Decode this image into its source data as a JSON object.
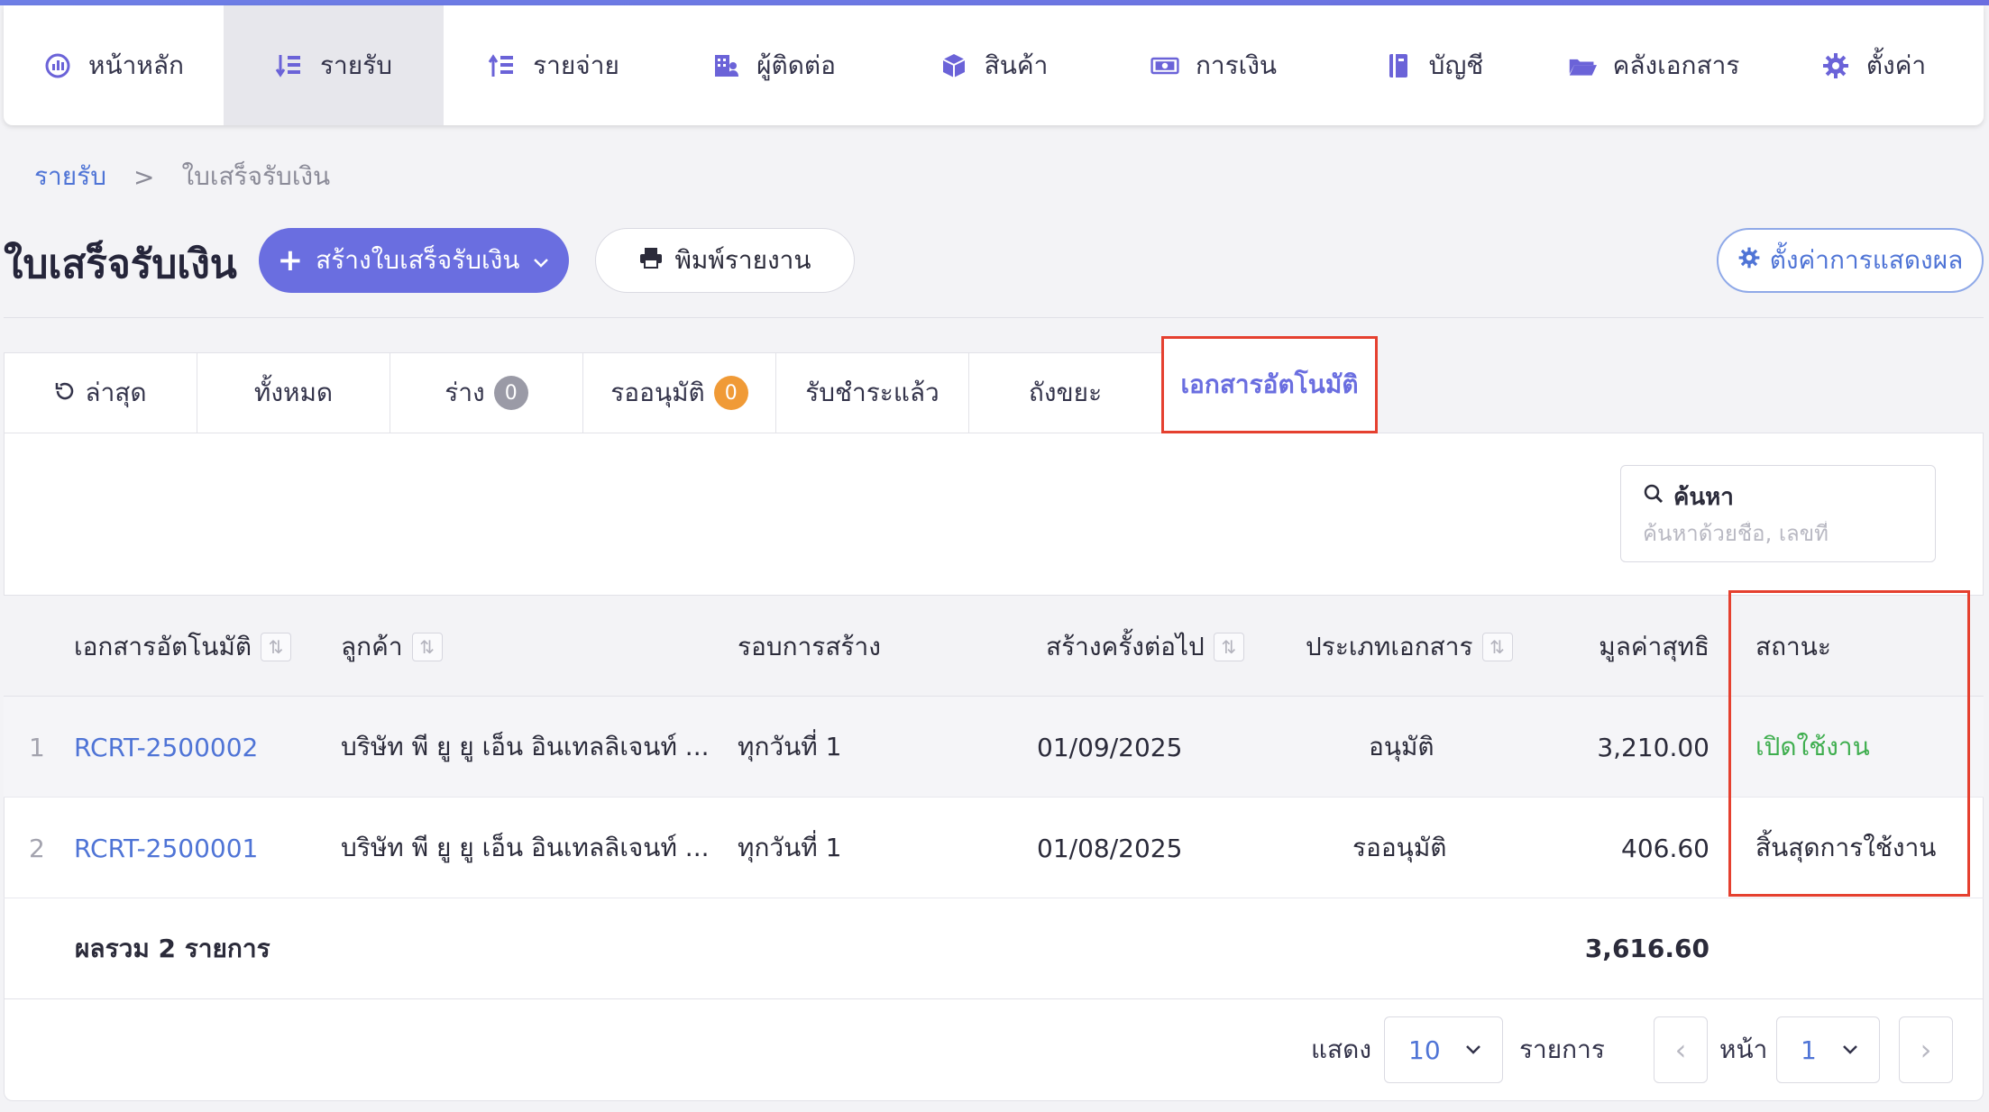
{
  "nav": {
    "items": [
      {
        "label": "หน้าหลัก",
        "icon": "dashboard-icon",
        "active": false
      },
      {
        "label": "รายรับ",
        "icon": "income-icon",
        "active": true
      },
      {
        "label": "รายจ่าย",
        "icon": "expense-icon",
        "active": false
      },
      {
        "label": "ผู้ติดต่อ",
        "icon": "contacts-icon",
        "active": false
      },
      {
        "label": "สินค้า",
        "icon": "box-icon",
        "active": false
      },
      {
        "label": "การเงิน",
        "icon": "money-icon",
        "active": false
      },
      {
        "label": "บัญชี",
        "icon": "ledger-icon",
        "active": false
      },
      {
        "label": "คลังเอกสาร",
        "icon": "folder-icon",
        "active": false
      },
      {
        "label": "ตั้งค่า",
        "icon": "gear-icon",
        "active": false
      }
    ]
  },
  "breadcrumb": {
    "parent": "รายรับ",
    "separator": ">",
    "current": "ใบเสร็จรับเงิน"
  },
  "header": {
    "title": "ใบเสร็จรับเงิน",
    "create_label": "สร้างใบเสร็จรับเงิน",
    "print_label": "พิมพ์รายงาน",
    "display_settings_label": "ตั้งค่าการแสดงผล"
  },
  "tabs": [
    {
      "label": "ล่าสุด"
    },
    {
      "label": "ทั้งหมด"
    },
    {
      "label": "ร่าง",
      "badge": "0"
    },
    {
      "label": "รออนุมัติ",
      "badge": "0"
    },
    {
      "label": "รับชำระแล้ว"
    },
    {
      "label": "ถังขยะ"
    },
    {
      "label": "เอกสารอัตโนมัติ",
      "active": true
    }
  ],
  "search": {
    "label": "ค้นหา",
    "placeholder": "ค้นหาด้วยชื่อ, เลขที่"
  },
  "table": {
    "columns": {
      "doc": "เอกสารอัตโนมัติ",
      "customer": "ลูกค้า",
      "cycle": "รอบการสร้าง",
      "next": "สร้างครั้งต่อไป",
      "type": "ประเภทเอกสาร",
      "net": "มูลค่าสุทธิ",
      "status": "สถานะ"
    },
    "rows": [
      {
        "num": "1",
        "doc": "RCRT-2500002",
        "customer": "บริษัท พี ยู ยู เอ็น อินเทลลิเจนท์ ...",
        "cycle": "ทุกวันที่ 1",
        "next": "01/09/2025",
        "type": "อนุมัติ",
        "net": "3,210.00",
        "status": "เปิดใช้งาน"
      },
      {
        "num": "2",
        "doc": "RCRT-2500001",
        "customer": "บริษัท พี ยู ยู เอ็น อินเทลลิเจนท์ ...",
        "cycle": "ทุกวันที่ 1",
        "next": "01/08/2025",
        "type": "รออนุมัติ",
        "net": "406.60",
        "status": "สิ้นสุดการใช้งาน"
      }
    ],
    "total_label": "ผลรวม 2 รายการ",
    "total_value": "3,616.60"
  },
  "pagination": {
    "show_label": "แสดง",
    "per_page": "10",
    "items_label": "รายการ",
    "page_label": "หน้า",
    "page": "1"
  },
  "colors": {
    "accent": "#6a6ee0",
    "link": "#4f74d6",
    "active_status": "#3fae4f",
    "highlight": "#e5402f"
  }
}
